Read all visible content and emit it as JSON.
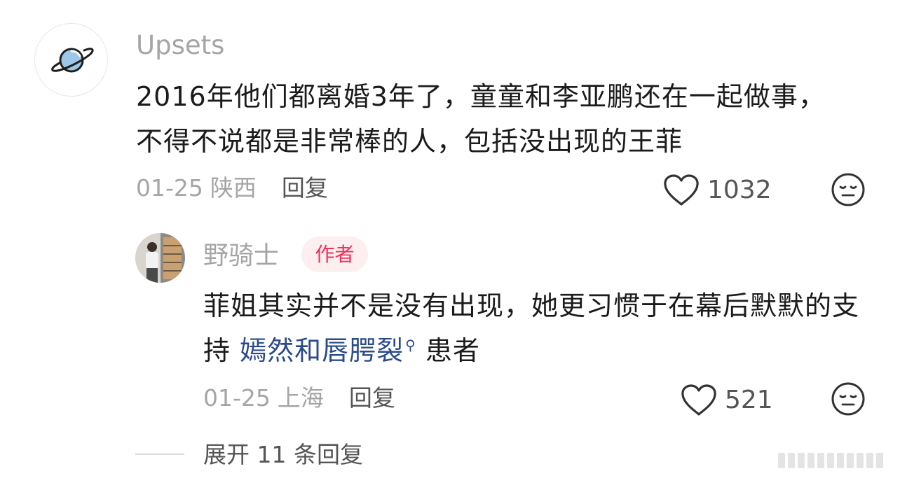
{
  "comment": {
    "username": "Upsets",
    "text": "2016年他们都离婚3年了，童童和李亚鹏还在一起做事，不得不说都是非常棒的人，包括没出现的王菲",
    "date": "01-25",
    "location": "陕西",
    "reply_label": "回复",
    "like_count": "1032"
  },
  "reply": {
    "username": "野骑士",
    "badge": "作者",
    "text_before": "菲姐其实并不是没有出现，她更习惯于在幕后默默的支持 ",
    "search_term": "嫣然和唇腭裂",
    "text_after": " 患者",
    "date": "01-25",
    "location": "上海",
    "reply_label": "回复",
    "like_count": "521"
  },
  "expand_replies_label": "展开 11 条回复",
  "colors": {
    "muted_text": "#a5a5a5",
    "body_text": "#1b1b1b",
    "secondary_text": "#555555",
    "badge_bg": "#fdeef0",
    "badge_text": "#f0305b",
    "search_link": "#2a4a8a",
    "planet_fill": "#9cc7e8"
  },
  "icons": {
    "avatar_main": "planet-icon",
    "like": "heart-outline-icon",
    "emoji": "neutral-face-icon",
    "search_mark": "search-icon"
  }
}
